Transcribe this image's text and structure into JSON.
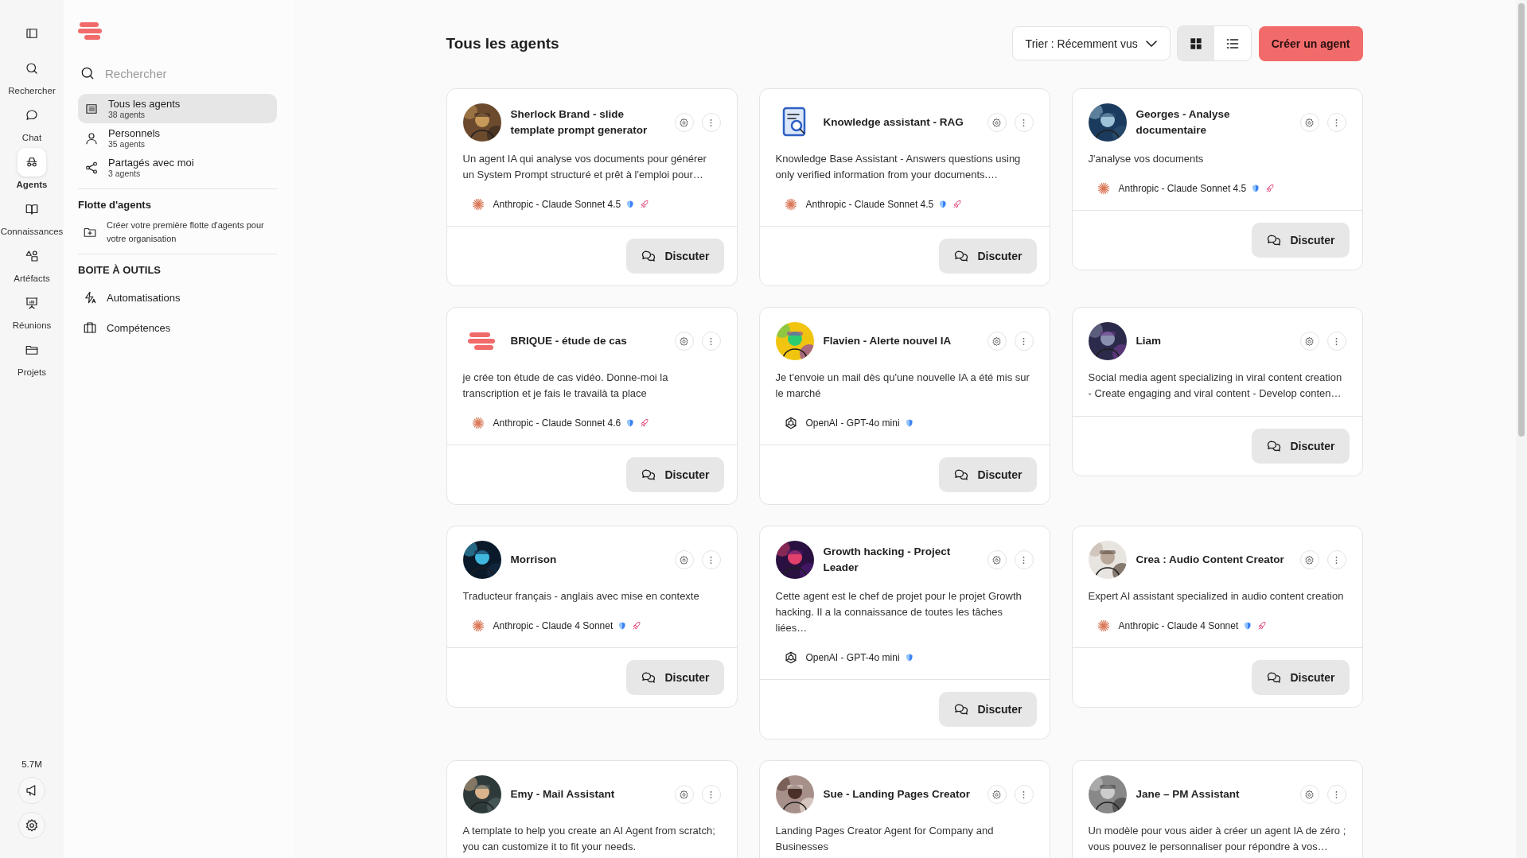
{
  "rail": {
    "items": [
      {
        "label": "Rechercher",
        "selected": false
      },
      {
        "label": "Chat",
        "selected": false
      },
      {
        "label": "Agents",
        "selected": true
      },
      {
        "label": "Connaissances",
        "selected": false
      },
      {
        "label": "Artéfacts",
        "selected": false
      },
      {
        "label": "Réunions",
        "selected": false
      },
      {
        "label": "Projets",
        "selected": false
      }
    ],
    "usage": "5.7M"
  },
  "sidebar": {
    "search": {
      "placeholder": "Rechercher"
    },
    "nav": [
      {
        "label": "Tous les agents",
        "count": "38 agents",
        "selected": true
      },
      {
        "label": "Personnels",
        "count": "35 agents",
        "selected": false
      },
      {
        "label": "Partagés avec moi",
        "count": "3 agents",
        "selected": false
      }
    ],
    "fleet": {
      "title": "Flotte d'agents",
      "hint": "Créer votre première flotte d'agents pour votre organisation"
    },
    "toolbox": {
      "title": "BOITE À OUTILS",
      "items": [
        {
          "label": "Automatisations"
        },
        {
          "label": "Compétences"
        }
      ]
    }
  },
  "main": {
    "title": "Tous les agents",
    "sort": "Trier : Récemment vus",
    "views": [
      {
        "kind": "grid",
        "selected": true
      },
      {
        "kind": "list",
        "selected": false
      }
    ],
    "create_button": "Créer un agent",
    "agents": [
      {
        "kind": "picture",
        "name": "Sherlock Brand - slide template prompt generator",
        "description": "Un agent IA qui analyse vos documents pour générer un System Prompt structuré et prêt à l'emploi pour…",
        "model": {
          "kind": "anthropic",
          "label": "Anthropic - Claude Sonnet 4.5",
          "rocket": true
        },
        "action": "Discuter"
      },
      {
        "kind": "document",
        "name": "Knowledge assistant - RAG",
        "description": "Knowledge Base Assistant - Answers questions using only verified information from your documents.…",
        "model": {
          "kind": "anthropic",
          "label": "Anthropic - Claude Sonnet 4.5",
          "rocket": true
        },
        "action": "Discuter"
      },
      {
        "kind": "picture",
        "name": "Georges - Analyse documentaire",
        "description": "J'analyse vos documents",
        "model": {
          "kind": "anthropic",
          "label": "Anthropic - Claude Sonnet 4.5",
          "rocket": true
        },
        "action": "Discuter"
      },
      {
        "kind": "logo",
        "name": "BRIQUE - étude de cas",
        "description": "je crée ton étude de cas vidéo. Donne-moi la transcription et je fais le travailà ta place",
        "model": {
          "kind": "anthropic",
          "label": "Anthropic - Claude Sonnet 4.6",
          "rocket": true
        },
        "action": "Discuter"
      },
      {
        "kind": "picture",
        "name": "Flavien - Alerte nouvel IA",
        "description": "Je t'envoie un mail dès qu'une nouvelle IA a été mis sur le marché",
        "model": {
          "kind": "openai",
          "label": "OpenAI - GPT-4o mini",
          "rocket": false
        },
        "action": "Discuter"
      },
      {
        "kind": "picture",
        "name": "Liam",
        "description": "Social media agent specializing in viral content creation - Create engaging and viral content - Develop conten…",
        "action": "Discuter"
      },
      {
        "kind": "picture",
        "name": "Morrison",
        "description": "Traducteur français - anglais avec mise en contexte",
        "model": {
          "kind": "anthropic",
          "label": "Anthropic - Claude 4 Sonnet",
          "rocket": true
        },
        "action": "Discuter"
      },
      {
        "kind": "picture",
        "name": "Growth hacking - Project Leader",
        "description": "Cette agent est le chef de projet pour le projet Growth hacking. Il a la connaissance de toutes les tâches liées…",
        "model": {
          "kind": "openai",
          "label": "OpenAI - GPT-4o mini",
          "rocket": false
        },
        "action": "Discuter"
      },
      {
        "kind": "picture",
        "name": "Crea : Audio Content Creator",
        "description": "Expert AI assistant specialized in audio content creation",
        "model": {
          "kind": "anthropic",
          "label": "Anthropic - Claude 4 Sonnet",
          "rocket": true
        },
        "action": "Discuter"
      },
      {
        "kind": "picture",
        "name": "Emy - Mail Assistant",
        "description": "A template to help you create an AI Agent from scratch; you can customize it to fit your needs."
      },
      {
        "kind": "picture",
        "name": "Sue - Landing Pages Creator",
        "description": "Landing Pages Creator Agent for Company and Businesses"
      },
      {
        "kind": "picture",
        "name": "Jane – PM Assistant",
        "description": "Un modèle pour vous aider à créer un agent IA de zéro ; vous pouvez le personnaliser pour répondre à vos…"
      }
    ]
  }
}
